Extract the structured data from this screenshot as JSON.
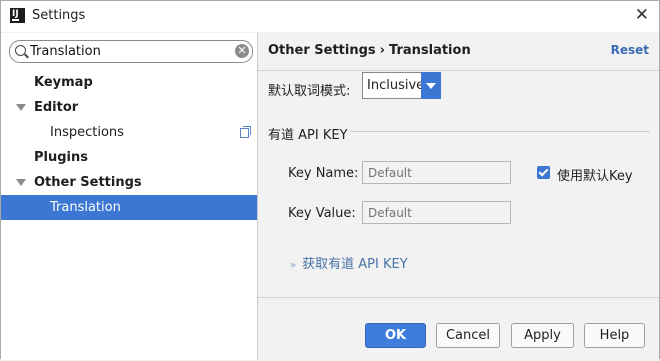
{
  "window": {
    "title": "Settings"
  },
  "search": {
    "value": "Translation"
  },
  "tree": [
    {
      "label": "Keymap"
    },
    {
      "label": "Editor"
    },
    {
      "label": "Inspections"
    },
    {
      "label": "Plugins"
    },
    {
      "label": "Other Settings"
    },
    {
      "label": "Translation"
    }
  ],
  "breadcrumb": {
    "parent": "Other Settings",
    "separator": "›",
    "current": "Translation"
  },
  "reset_label": "Reset",
  "mode": {
    "label": "默认取词模式:",
    "value": "Inclusive"
  },
  "group": {
    "title": "有道 API KEY"
  },
  "key_name": {
    "label": "Key Name:",
    "placeholder": "Default"
  },
  "key_value": {
    "label": "Key Value:",
    "placeholder": "Default"
  },
  "use_default": {
    "label": "使用默认Key",
    "checked": true
  },
  "get_key_link": {
    "chevron": "»",
    "label": "获取有道 API KEY"
  },
  "buttons": {
    "ok": "OK",
    "cancel": "Cancel",
    "apply": "Apply",
    "help": "Help"
  },
  "colors": {
    "accent": "#3d77d4",
    "link": "#3b6cb5"
  }
}
